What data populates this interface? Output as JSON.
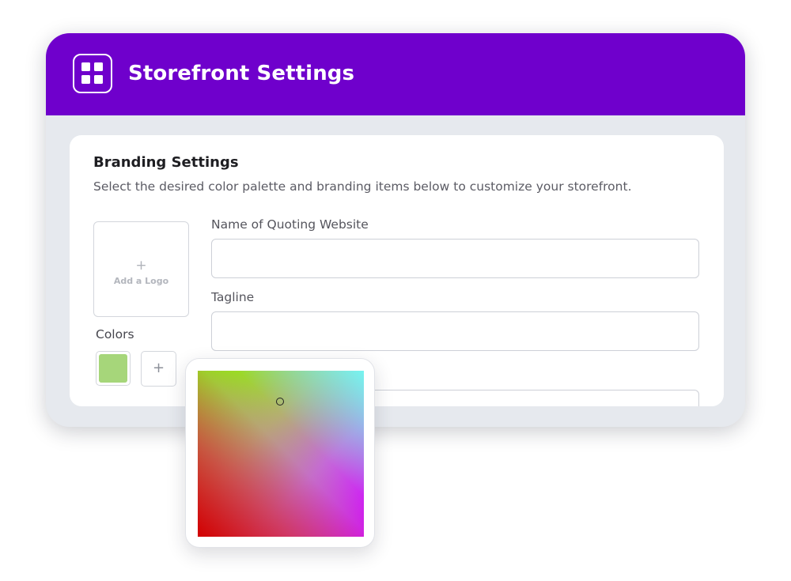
{
  "header": {
    "title": "Storefront Settings",
    "icon": "grid-icon",
    "background_color": "#6f00cc"
  },
  "branding": {
    "title": "Branding Settings",
    "description": "Select the desired color palette and branding items below to customize your storefront.",
    "logo": {
      "plus": "+",
      "label": "Add a Logo"
    },
    "colors": {
      "label": "Colors",
      "swatches": [
        "#a6d67a"
      ],
      "add_label": "+"
    },
    "fields": [
      {
        "label": "Name of Quoting Website",
        "value": "",
        "placeholder": ""
      },
      {
        "label": "Tagline",
        "value": "",
        "placeholder": ""
      },
      {
        "label": "",
        "value": "",
        "placeholder": ""
      }
    ]
  },
  "color_picker": {
    "hue_gradient": [
      "#8ef000",
      "#6efafa",
      "#d300ff",
      "#d20000"
    ]
  }
}
